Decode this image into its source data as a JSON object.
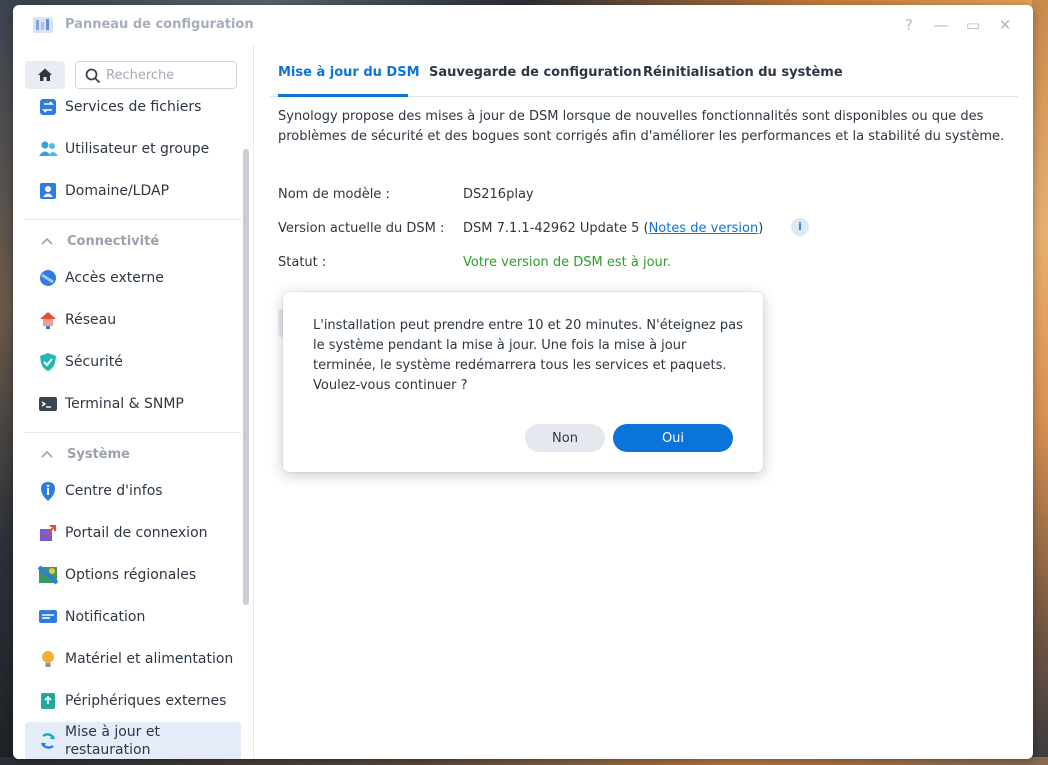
{
  "window": {
    "title": "Panneau de configuration",
    "controls": {
      "help": "?",
      "minimize": "—",
      "maximize": "▭",
      "close": "✕"
    }
  },
  "sidebar": {
    "search_placeholder": "Recherche",
    "items_top": [
      {
        "label": "Services de fichiers",
        "icon": "file-services-icon"
      },
      {
        "label": "Utilisateur et groupe",
        "icon": "users-icon"
      },
      {
        "label": "Domaine/LDAP",
        "icon": "domain-icon"
      }
    ],
    "sections": [
      {
        "title": "Connectivité",
        "items": [
          {
            "label": "Accès externe",
            "icon": "external-access-icon"
          },
          {
            "label": "Réseau",
            "icon": "network-icon"
          },
          {
            "label": "Sécurité",
            "icon": "security-shield-icon"
          },
          {
            "label": "Terminal & SNMP",
            "icon": "terminal-icon"
          }
        ]
      },
      {
        "title": "Système",
        "items": [
          {
            "label": "Centre d'infos",
            "icon": "info-center-icon"
          },
          {
            "label": "Portail de connexion",
            "icon": "login-portal-icon"
          },
          {
            "label": "Options régionales",
            "icon": "regional-options-icon"
          },
          {
            "label": "Notification",
            "icon": "notification-icon"
          },
          {
            "label": "Matériel et alimentation",
            "icon": "hardware-power-icon"
          },
          {
            "label": "Périphériques externes",
            "icon": "external-devices-icon"
          },
          {
            "label": "Mise à jour et restauration",
            "icon": "update-restore-icon",
            "active": true
          }
        ]
      }
    ]
  },
  "tabs": [
    {
      "label": "Mise à jour du DSM",
      "active": true
    },
    {
      "label": "Sauvegarde de configuration",
      "active": false
    },
    {
      "label": "Réinitialisation du système",
      "active": false
    }
  ],
  "update": {
    "intro": "Synology propose des mises à jour de DSM lorsque de nouvelles fonctionnalités sont disponibles ou que des problèmes de sécurité et des bogues sont corrigés afin d'améliorer les performances et la stabilité du système.",
    "model_label": "Nom de modèle :",
    "model_value": "DS216play",
    "version_label": "Version actuelle du DSM :",
    "version_value": "DSM 7.1.1-42962 Update 5 (",
    "release_notes_link": "Notes de version",
    "version_suffix": ")",
    "status_label": "Statut :",
    "status_value": "Votre version de DSM est à jour.",
    "status_color": "#2ba02b"
  },
  "dialog": {
    "message": "L'installation peut prendre entre 10 et 20 minutes. N'éteignez pas le système pendant la mise à jour. Une fois la mise à jour terminée, le système redémarrera tous les services et paquets. Voulez-vous continuer ?",
    "no_label": "Non",
    "yes_label": "Oui"
  },
  "colors": {
    "accent": "#0b74d8",
    "active_item_bg": "#e3ecf8",
    "success": "#2ba02b"
  }
}
